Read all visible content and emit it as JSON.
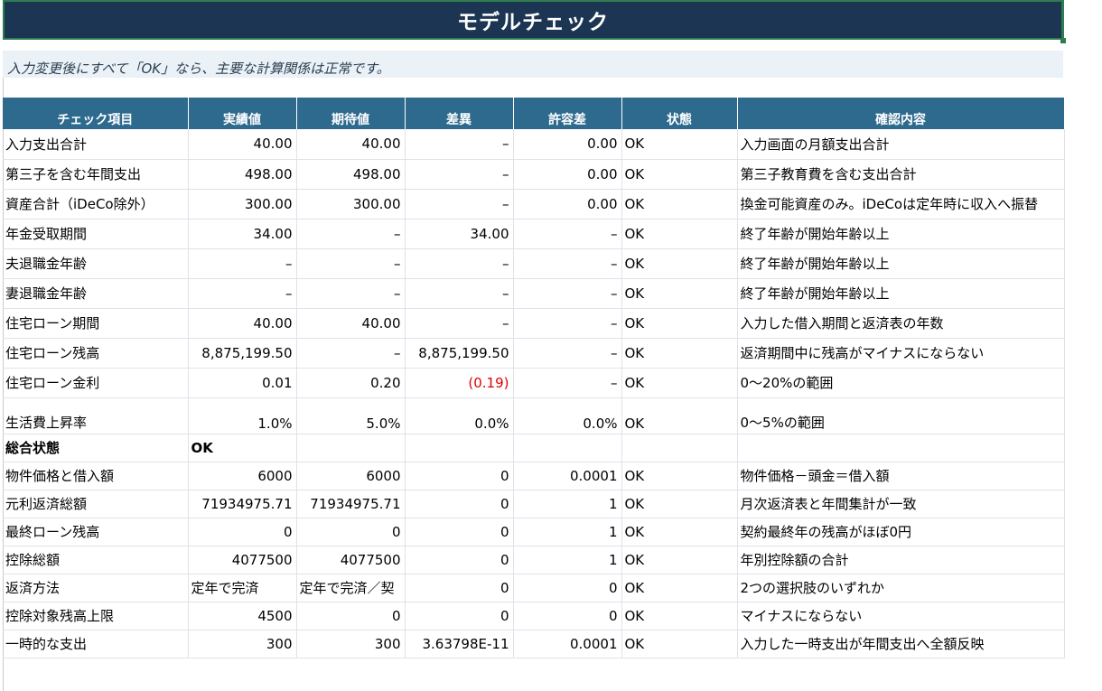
{
  "title": "モデルチェック",
  "note": "入力変更後にすべて「OK」なら、主要な計算関係は正常です。",
  "headers": [
    "チェック項目",
    "実績値",
    "期待値",
    "差異",
    "許容差",
    "状態",
    "確認内容"
  ],
  "rows": [
    [
      "入力支出合計",
      "40.00",
      "40.00",
      "–",
      "0.00",
      "OK",
      "入力画面の月額支出合計"
    ],
    [
      "第三子を含む年間支出",
      "498.00",
      "498.00",
      "–",
      "0.00",
      "OK",
      "第三子教育費を含む支出合計"
    ],
    [
      "資産合計（iDeCo除外）",
      "300.00",
      "300.00",
      "–",
      "0.00",
      "OK",
      "換金可能資産のみ。iDeCoは定年時に収入へ振替"
    ],
    [
      "年金受取期間",
      "34.00",
      "–",
      "34.00",
      "–",
      "OK",
      "終了年齢が開始年齢以上"
    ],
    [
      "夫退職金年齢",
      "–",
      "–",
      "–",
      "–",
      "OK",
      "終了年齢が開始年齢以上"
    ],
    [
      "妻退職金年齢",
      "–",
      "–",
      "–",
      "–",
      "OK",
      "終了年齢が開始年齢以上"
    ],
    [
      "住宅ローン期間",
      "40.00",
      "40.00",
      "–",
      "–",
      "OK",
      "入力した借入期間と返済表の年数"
    ],
    [
      "住宅ローン残高",
      "8,875,199.50",
      "–",
      "8,875,199.50",
      "–",
      "OK",
      "返済期間中に残高がマイナスにならない"
    ],
    [
      "住宅ローン金利",
      "0.01",
      "0.20",
      "(0.19)",
      "–",
      "OK",
      "0〜20%の範囲"
    ],
    [
      "生活費上昇率",
      "1.0%",
      "5.0%",
      "0.0%",
      "0.0%",
      "OK",
      "0〜5%の範囲"
    ],
    [
      "総合状態",
      "OK",
      "",
      "",
      "",
      "",
      ""
    ],
    [
      "物件価格と借入額",
      "6000",
      "6000",
      "0",
      "0.0001",
      "OK",
      "物件価格－頭金＝借入額"
    ],
    [
      "元利返済総額",
      "71934975.71",
      "71934975.71",
      "0",
      "1",
      "OK",
      "月次返済表と年間集計が一致"
    ],
    [
      "最終ローン残高",
      "0",
      "0",
      "0",
      "1",
      "OK",
      "契約最終年の残高がほぼ0円"
    ],
    [
      "控除総額",
      "4077500",
      "4077500",
      "0",
      "1",
      "OK",
      "年別控除額の合計"
    ],
    [
      "返済方法",
      "定年で完済",
      "定年で完済／契",
      "0",
      "0",
      "OK",
      "2つの選択肢のいずれか"
    ],
    [
      "控除対象残高上限",
      "4500",
      "0",
      "0",
      "0",
      "OK",
      "マイナスにならない"
    ],
    [
      "一時的な支出",
      "300",
      "300",
      "3.63798E-11",
      "0.0001",
      "OK",
      "入力した一時支出が年間支出へ全額反映"
    ]
  ],
  "colors": {
    "title_bg": "#1b3552",
    "header_bg": "#2e6a8e",
    "note_bg": "#eaf1f7",
    "negative": "#e00000"
  }
}
